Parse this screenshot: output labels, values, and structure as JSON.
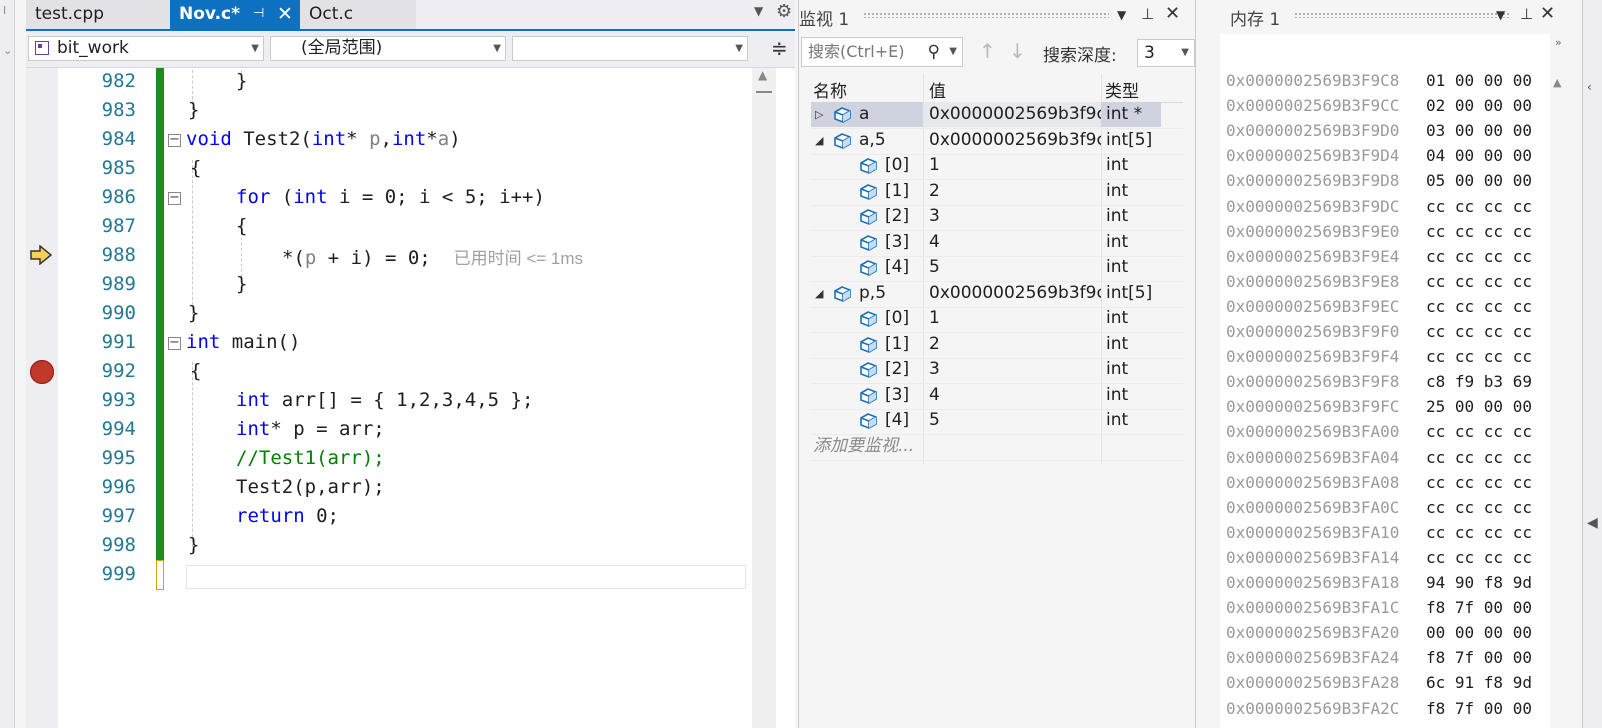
{
  "editor": {
    "tabs": [
      {
        "label": "test.cpp",
        "active": false
      },
      {
        "label": "Nov.c*",
        "active": true
      },
      {
        "label": "Oct.c",
        "active": false
      }
    ],
    "project_combo": "bit_work",
    "scope_combo": "(全局范围)",
    "member_combo": "",
    "line_numbers": [
      "982",
      "983",
      "984",
      "985",
      "986",
      "987",
      "988",
      "989",
      "990",
      "991",
      "992",
      "993",
      "994",
      "995",
      "996",
      "997",
      "998",
      "999"
    ],
    "perf_tip": "已用时间 <= 1ms",
    "code": {
      "l982": "}",
      "l983": "}",
      "l984_kw": "void",
      "l984_fn": " Test2(",
      "l984_t1": "int",
      "l984_a": "* ",
      "l984_p1": "p",
      "l984_b": ",",
      "l984_t2": "int",
      "l984_c": "*",
      "l984_p2": "a",
      "l984_d": ")",
      "l985": "{",
      "l986_kw": "for",
      "l986_a": " (",
      "l986_t": "int",
      "l986_b": " i = 0; i < 5; i++)",
      "l987": "{",
      "l988_a": "*(",
      "l988_p": "p",
      "l988_b": " + i) = 0;",
      "l989": "}",
      "l990": "}",
      "l991_t": "int",
      "l991_b": " main()",
      "l992": "{",
      "l993_t": "int",
      "l993_b": " arr[] = { 1,2,3,4,5 };",
      "l994_t": "int",
      "l994_b": "* p = arr;",
      "l995": "//Test1(arr);",
      "l996": "Test2(p,arr);",
      "l997_kw": "return",
      "l997_b": " 0;",
      "l998": "}"
    }
  },
  "watch": {
    "title": "监视 1",
    "search_placeholder": "搜索(Ctrl+E)",
    "depth_label": "搜索深度:",
    "depth_value": "3",
    "headers": {
      "name": "名称",
      "value": "值",
      "type": "类型"
    },
    "rows": [
      {
        "name": "a",
        "value": "0x0000002569b3f9c...",
        "type": "int *",
        "expander": "▷",
        "level": 0
      },
      {
        "name": "a,5",
        "value": "0x0000002569b3f9c...",
        "type": "int[5]",
        "expander": "◢",
        "level": 0
      },
      {
        "name": "[0]",
        "value": "1",
        "type": "int",
        "expander": "",
        "level": 1
      },
      {
        "name": "[1]",
        "value": "2",
        "type": "int",
        "expander": "",
        "level": 1
      },
      {
        "name": "[2]",
        "value": "3",
        "type": "int",
        "expander": "",
        "level": 1
      },
      {
        "name": "[3]",
        "value": "4",
        "type": "int",
        "expander": "",
        "level": 1
      },
      {
        "name": "[4]",
        "value": "5",
        "type": "int",
        "expander": "",
        "level": 1
      },
      {
        "name": "p,5",
        "value": "0x0000002569b3f9c...",
        "type": "int[5]",
        "expander": "◢",
        "level": 0
      },
      {
        "name": "[0]",
        "value": "1",
        "type": "int",
        "expander": "",
        "level": 1
      },
      {
        "name": "[1]",
        "value": "2",
        "type": "int",
        "expander": "",
        "level": 1
      },
      {
        "name": "[2]",
        "value": "3",
        "type": "int",
        "expander": "",
        "level": 1
      },
      {
        "name": "[3]",
        "value": "4",
        "type": "int",
        "expander": "",
        "level": 1
      },
      {
        "name": "[4]",
        "value": "5",
        "type": "int",
        "expander": "",
        "level": 1
      }
    ],
    "add_watch": "添加要监视..."
  },
  "memory": {
    "title": "内存 1",
    "rows": [
      {
        "addr": "0x0000002569B3F9C8",
        "bytes": "01 00 00 00"
      },
      {
        "addr": "0x0000002569B3F9CC",
        "bytes": "02 00 00 00"
      },
      {
        "addr": "0x0000002569B3F9D0",
        "bytes": "03 00 00 00"
      },
      {
        "addr": "0x0000002569B3F9D4",
        "bytes": "04 00 00 00"
      },
      {
        "addr": "0x0000002569B3F9D8",
        "bytes": "05 00 00 00"
      },
      {
        "addr": "0x0000002569B3F9DC",
        "bytes": "cc cc cc cc"
      },
      {
        "addr": "0x0000002569B3F9E0",
        "bytes": "cc cc cc cc"
      },
      {
        "addr": "0x0000002569B3F9E4",
        "bytes": "cc cc cc cc"
      },
      {
        "addr": "0x0000002569B3F9E8",
        "bytes": "cc cc cc cc"
      },
      {
        "addr": "0x0000002569B3F9EC",
        "bytes": "cc cc cc cc"
      },
      {
        "addr": "0x0000002569B3F9F0",
        "bytes": "cc cc cc cc"
      },
      {
        "addr": "0x0000002569B3F9F4",
        "bytes": "cc cc cc cc"
      },
      {
        "addr": "0x0000002569B3F9F8",
        "bytes": "c8 f9 b3 69"
      },
      {
        "addr": "0x0000002569B3F9FC",
        "bytes": "25 00 00 00"
      },
      {
        "addr": "0x0000002569B3FA00",
        "bytes": "cc cc cc cc"
      },
      {
        "addr": "0x0000002569B3FA04",
        "bytes": "cc cc cc cc"
      },
      {
        "addr": "0x0000002569B3FA08",
        "bytes": "cc cc cc cc"
      },
      {
        "addr": "0x0000002569B3FA0C",
        "bytes": "cc cc cc cc"
      },
      {
        "addr": "0x0000002569B3FA10",
        "bytes": "cc cc cc cc"
      },
      {
        "addr": "0x0000002569B3FA14",
        "bytes": "cc cc cc cc"
      },
      {
        "addr": "0x0000002569B3FA18",
        "bytes": "94 90 f8 9d"
      },
      {
        "addr": "0x0000002569B3FA1C",
        "bytes": "f8 7f 00 00"
      },
      {
        "addr": "0x0000002569B3FA20",
        "bytes": "00 00 00 00"
      },
      {
        "addr": "0x0000002569B3FA24",
        "bytes": "f8 7f 00 00"
      },
      {
        "addr": "0x0000002569B3FA28",
        "bytes": "6c 91 f8 9d"
      },
      {
        "addr": "0x0000002569B3FA2C",
        "bytes": "f8 7f 00 00"
      }
    ]
  },
  "icons": {
    "pin": "pin-icon",
    "close": "close-icon",
    "gear": "gear-icon",
    "search": "search-icon",
    "dropdown": "chevron-down-icon",
    "next_statement": "next-statement-arrow-icon",
    "breakpoint": "breakpoint-icon",
    "variable": "variable-cube-icon"
  },
  "colors": {
    "accent": "#0e70c0",
    "keyword": "#0000ff",
    "type": "#2b91af",
    "comment": "#008000",
    "changed_bar": "#1f8a1f",
    "breakpoint": "#c0392b"
  }
}
